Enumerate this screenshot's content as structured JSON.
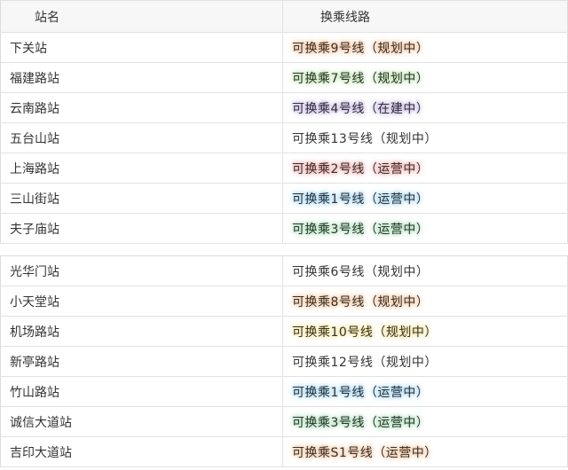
{
  "header": {
    "station_col": "站名",
    "line_col": "换乘线路"
  },
  "group1": [
    {
      "station": "下关站",
      "line": "可换乘9号线（规划中）",
      "glow": "#f3a66b"
    },
    {
      "station": "福建路站",
      "line": "可换乘7号线（规划中）",
      "glow": "#9fd889"
    },
    {
      "station": "云南路站",
      "line": "可换乘4号线（在建中）",
      "glow": "#b29be0"
    },
    {
      "station": "五台山站",
      "line": "可换乘13号线（规划中）",
      "glow": ""
    },
    {
      "station": "上海路站",
      "line": "可换乘2号线（运营中）",
      "glow": "#f08a8a"
    },
    {
      "station": "三山街站",
      "line": "可换乘1号线（运营中）",
      "glow": "#7cc6f0"
    },
    {
      "station": "夫子庙站",
      "line": "可换乘3号线（运营中）",
      "glow": "#86d59a"
    }
  ],
  "group2": [
    {
      "station": "光华门站",
      "line": "可换乘6号线（规划中）",
      "glow": ""
    },
    {
      "station": "小天堂站",
      "line": "可换乘8号线（规划中）",
      "glow": "#f3b076"
    },
    {
      "station": "机场路站",
      "line": "可换乘10号线（规划中）",
      "glow": "#f3da6e"
    },
    {
      "station": "新亭路站",
      "line": "可换乘12号线（规划中）",
      "glow": ""
    },
    {
      "station": "竹山路站",
      "line": "可换乘1号线（运营中）",
      "glow": "#7cc6f0"
    },
    {
      "station": "诚信大道站",
      "line": "可换乘3号线（运营中）",
      "glow": "#86d59a"
    },
    {
      "station": "吉印大道站",
      "line": "可换乘S1号线（运营中）",
      "glow": "#f3b076"
    }
  ]
}
